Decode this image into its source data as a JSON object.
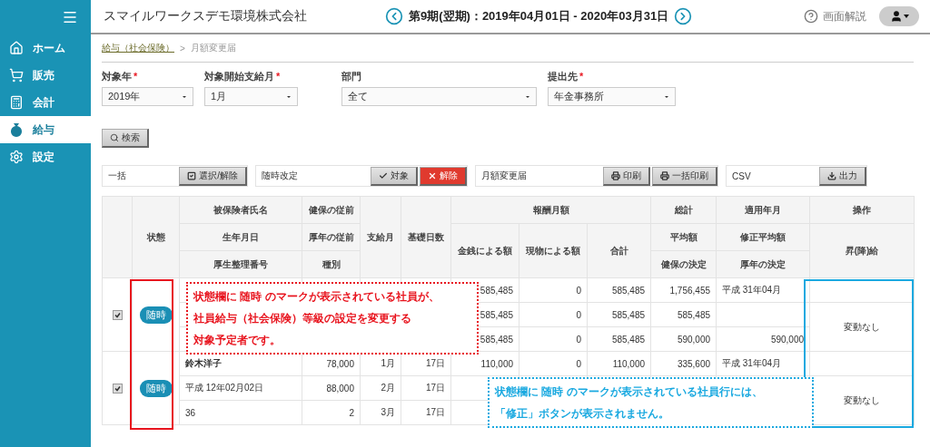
{
  "sidebar": {
    "items": [
      {
        "label": "ホーム",
        "selected": false
      },
      {
        "label": "販売",
        "selected": false
      },
      {
        "label": "会計",
        "selected": false
      },
      {
        "label": "給与",
        "selected": true
      },
      {
        "label": "設定",
        "selected": false
      }
    ]
  },
  "header": {
    "company": "スマイルワークスデモ環境株式会社",
    "period": "第9期(翌期)：2019年04月01日 - 2020年03月31日",
    "help": "画面解説"
  },
  "breadcrumb": {
    "link": "給与（社会保険）",
    "separator": ">",
    "current": "月額変更届"
  },
  "filters": [
    {
      "label": "対象年",
      "required": true,
      "value": "2019年"
    },
    {
      "label": "対象開始支給月",
      "required": true,
      "value": "1月"
    },
    {
      "label": "部門",
      "required": false,
      "value": "全て"
    },
    {
      "label": "提出先",
      "required": true,
      "value": "年金事務所"
    }
  ],
  "required_mark": "*",
  "search_button": "検索",
  "action_groups": [
    {
      "label": "一括",
      "buttons": [
        {
          "label": "選択/解除",
          "danger": false
        }
      ]
    },
    {
      "label": "随時改定",
      "buttons": [
        {
          "label": "対象",
          "danger": false
        },
        {
          "label": "解除",
          "danger": true
        }
      ]
    },
    {
      "label": "月額変更届",
      "buttons": [
        {
          "label": "印刷",
          "danger": false
        },
        {
          "label": "一括印刷",
          "danger": false
        }
      ]
    },
    {
      "label": "CSV",
      "buttons": [
        {
          "label": "出力",
          "danger": false
        }
      ]
    }
  ],
  "table": {
    "header": {
      "status": "状態",
      "name_col": [
        "被保険者氏名",
        "生年月日",
        "厚生整理番号"
      ],
      "prior": [
        "健保の従前",
        "厚年の従前",
        "種別"
      ],
      "pay_month": "支給月",
      "base_days": "基礎日数",
      "remuneration": {
        "title": "報酬月額",
        "columns": [
          "金銭による額",
          "現物による額",
          "合計"
        ]
      },
      "total": [
        "総計",
        "平均額",
        "健保の決定"
      ],
      "applied": [
        "適用年月",
        "修正平均額",
        "厚年の決定"
      ],
      "operation": [
        "操作",
        "昇(降)給"
      ]
    },
    "employees": [
      {
        "checked": true,
        "status": "随時",
        "operation": "変動なし",
        "rows": [
          [
            null,
            null,
            null,
            null,
            "585,485",
            "0",
            "585,485",
            "1,756,455",
            "平成 31年04月"
          ],
          [
            null,
            null,
            null,
            null,
            "585,485",
            "0",
            "585,485",
            "585,485",
            null
          ],
          [
            null,
            null,
            null,
            null,
            "585,485",
            "0",
            "585,485",
            "590,000",
            "590,000"
          ]
        ]
      },
      {
        "checked": true,
        "status": "随時",
        "operation": "変動なし",
        "rows": [
          [
            "鈴木洋子",
            "78,000",
            "1月",
            "17日",
            "110,000",
            "0",
            "110,000",
            "335,600",
            "平成 31年04月"
          ],
          [
            "平成 12年02月02日",
            "88,000",
            "2月",
            "17日",
            null,
            null,
            null,
            null,
            null
          ],
          [
            "36",
            "2",
            "3月",
            "17日",
            null,
            null,
            null,
            null,
            null
          ]
        ]
      }
    ]
  },
  "highlights": [
    {
      "color": "#e8141e"
    },
    {
      "color": "#1aa9e0"
    }
  ],
  "callouts": [
    {
      "color": "#e8141e",
      "lines": [
        "状態欄に 随時 のマークが表示されている社員が、",
        "社員給与（社会保険）等級の設定を変更する",
        "対象予定者です。"
      ]
    },
    {
      "color": "#1aa9e0",
      "lines": [
        "状態欄に 随時 のマークが表示されている社員行には、",
        "「修正」ボタンが表示されません。"
      ]
    }
  ]
}
